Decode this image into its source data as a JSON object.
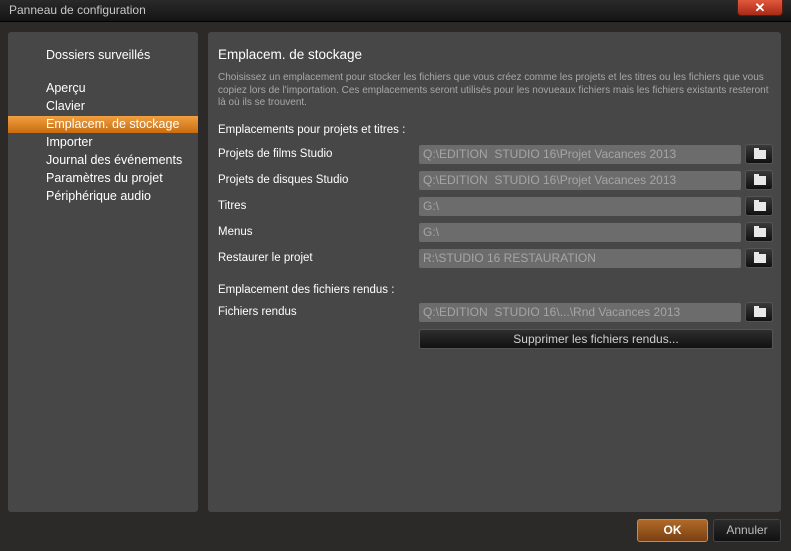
{
  "window": {
    "title": "Panneau de configuration",
    "close": "✕"
  },
  "sidebar": {
    "items": [
      {
        "label": "Dossiers surveillés"
      },
      {
        "label": "Aperçu"
      },
      {
        "label": "Clavier"
      },
      {
        "label": "Emplacem. de stockage",
        "selected": true
      },
      {
        "label": "Importer"
      },
      {
        "label": "Journal des événements"
      },
      {
        "label": "Paramètres du projet"
      },
      {
        "label": "Périphérique audio"
      }
    ]
  },
  "main": {
    "heading": "Emplacem. de stockage",
    "description": "Choisissez un emplacement pour stocker les fichiers que vous créez comme les projets et les titres ou les fichiers que vous copiez lors de l'importation. Ces emplacements seront utilisés pour les novueaux fichiers mais les fichiers existants resteront là où ils se trouvent.",
    "section1": "Emplacements pour projets et titres :",
    "rows": [
      {
        "label": "Projets de films Studio",
        "value": "Q:\\EDITION  STUDIO 16\\Projet Vacances 2013"
      },
      {
        "label": "Projets de disques Studio",
        "value": "Q:\\EDITION  STUDIO 16\\Projet Vacances 2013"
      },
      {
        "label": "Titres",
        "value": "G:\\"
      },
      {
        "label": "Menus",
        "value": "G:\\"
      },
      {
        "label": "Restaurer le projet",
        "value": "R:\\STUDIO 16 RESTAURATION"
      }
    ],
    "section2": "Emplacement des fichiers rendus :",
    "render_row": {
      "label": "Fichiers rendus",
      "value": "Q:\\EDITION  STUDIO 16\\...\\Rnd Vacances 2013"
    },
    "delete_button": "Supprimer les fichiers rendus..."
  },
  "footer": {
    "ok": "OK",
    "cancel": "Annuler"
  }
}
